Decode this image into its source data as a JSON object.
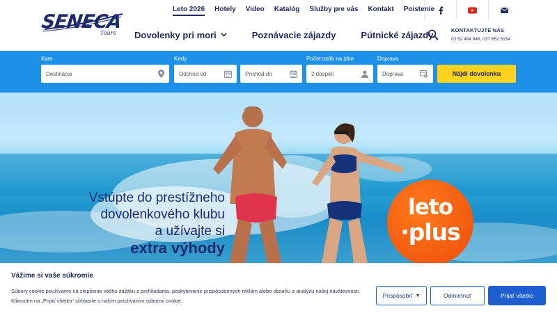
{
  "logo": {
    "name": "SENECA",
    "sub": "Tours"
  },
  "top_nav": {
    "items": [
      "Leto 2026",
      "Hotely",
      "Video",
      "Katalóg",
      "Služby pre vás",
      "Kontakt",
      "Poistenie"
    ]
  },
  "social": {
    "icons": [
      "facebook-icon",
      "youtube-icon",
      "mail-icon"
    ]
  },
  "main_nav": {
    "items": [
      "Dovolenky pri mori",
      "Poznávacie zájazdy",
      "Pútnické zájazdy"
    ]
  },
  "contact": {
    "title": "KONTAKTUJTE NÁS",
    "phones": "02 52 494 946, 037 652 5154"
  },
  "search": {
    "fields": [
      {
        "label": "Kam",
        "placeholder": "Destinácia",
        "icon": "map-pin-icon"
      },
      {
        "label": "Kedy",
        "placeholder": "Odchod od",
        "icon": "calendar-icon"
      },
      {
        "label": "",
        "placeholder": "Príchod do",
        "icon": "calendar-icon"
      },
      {
        "label": "Počet osôb na izbe",
        "placeholder": "2 dospelí",
        "icon": "person-icon"
      },
      {
        "label": "Doprava",
        "placeholder": "Doprava",
        "icon": "transport-icon"
      }
    ],
    "button": "Nájdi dovolenku"
  },
  "hero": {
    "lines": [
      "Vstúpte do prestížneho",
      "dovolenkového klubu",
      "a užívajte si",
      "extra výhody"
    ],
    "badge": {
      "line1": "leto",
      "line2": "·plus"
    },
    "colors": {
      "badge": "#f25a10",
      "sea": "#1a8cc7"
    }
  },
  "cookie": {
    "title": "Vážime si vaše súkromie",
    "text": "Súbory cookie používame na zlepšenie vášho zážitku z prehliadania, poskytovanie prispôsobených reklám alebo obsahu a analýzu našej návštevnosti. Kliknutím na „Prijať všetko“ súhlasíte s naším používaním súborov cookie.",
    "buttons": {
      "customize": "Prispôsobiť",
      "reject": "Odmietnuť",
      "accept": "Prijať všetko"
    }
  },
  "colors": {
    "brand_navy": "#1d2a5c",
    "search_blue": "#1e90e8",
    "cta_yellow": "#ffd21f",
    "accept_blue": "#1d5fd0"
  }
}
